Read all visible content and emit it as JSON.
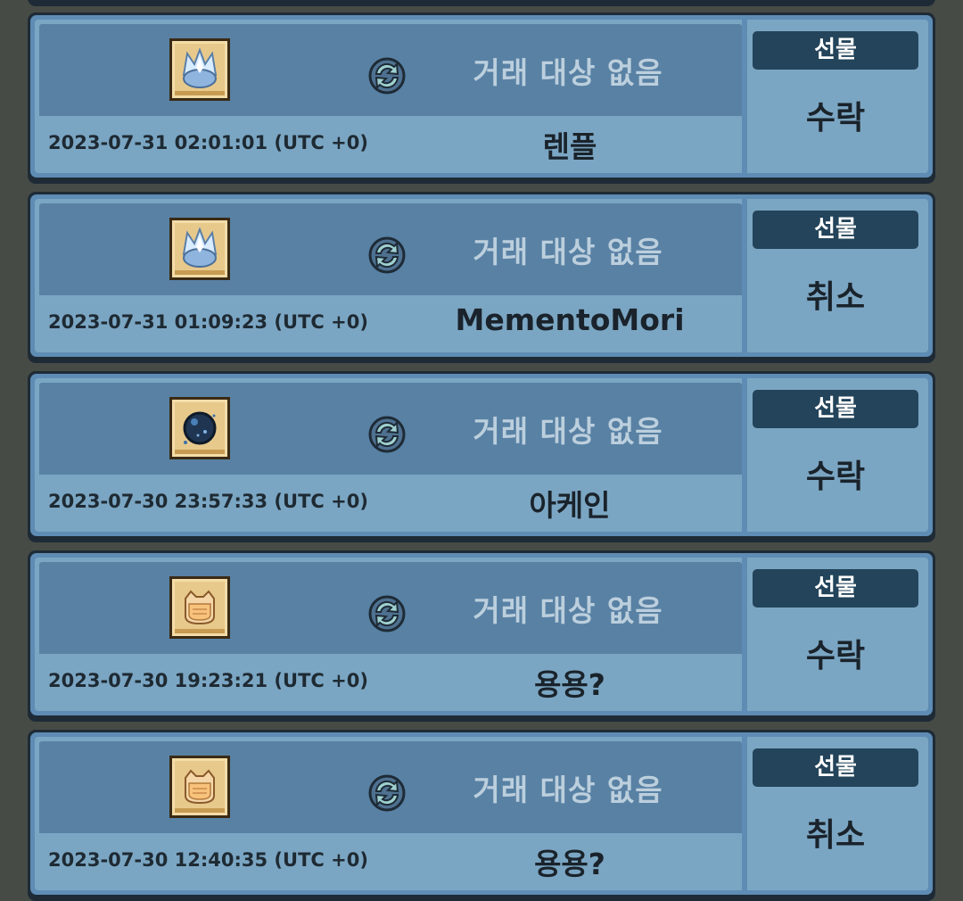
{
  "colors": {
    "page_bg": "#474b46",
    "card_outline": "#1e2b36",
    "card_top": "#5881a4",
    "card_bottom": "#7ba6c3",
    "badge_bg": "#23445a"
  },
  "records": [
    {
      "item_icon": "crystal-crown-icon",
      "swap_icon": "exchange-arrows-icon",
      "trade_target": "거래 대상 없음",
      "timestamp": "2023-07-31 02:01:01 (UTC +0)",
      "username": "렌플",
      "type": "선물",
      "status": "수락"
    },
    {
      "item_icon": "crystal-crown-icon",
      "swap_icon": "exchange-arrows-icon",
      "trade_target": "거래 대상 없음",
      "timestamp": "2023-07-31 01:09:23 (UTC +0)",
      "username": "MementoMori",
      "type": "선물",
      "status": "취소"
    },
    {
      "item_icon": "dark-orb-icon",
      "swap_icon": "exchange-arrows-icon",
      "trade_target": "거래 대상 없음",
      "timestamp": "2023-07-30 23:57:33 (UTC +0)",
      "username": "아케인",
      "type": "선물",
      "status": "수락"
    },
    {
      "item_icon": "cat-mask-icon",
      "swap_icon": "exchange-arrows-icon",
      "trade_target": "거래 대상 없음",
      "timestamp": "2023-07-30 19:23:21 (UTC +0)",
      "username": "용용?",
      "type": "선물",
      "status": "수락"
    },
    {
      "item_icon": "cat-mask-icon",
      "swap_icon": "exchange-arrows-icon",
      "trade_target": "거래 대상 없음",
      "timestamp": "2023-07-30 12:40:35 (UTC +0)",
      "username": "용용?",
      "type": "선물",
      "status": "취소"
    }
  ]
}
